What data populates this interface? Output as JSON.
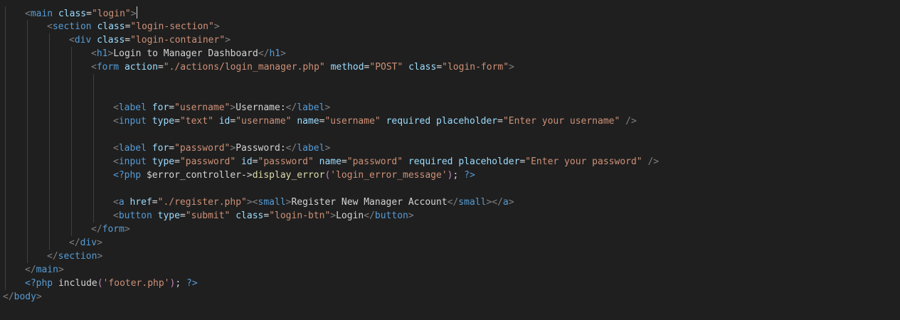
{
  "editor": {
    "lines": [
      {
        "indent": 1,
        "cursor": true,
        "tokens": [
          [
            "punc",
            "<"
          ],
          [
            "tag",
            "main"
          ],
          [
            "text",
            " "
          ],
          [
            "attr",
            "class"
          ],
          [
            "text",
            "="
          ],
          [
            "str",
            "\"login\""
          ],
          [
            "punc",
            ">"
          ]
        ]
      },
      {
        "indent": 2,
        "tokens": [
          [
            "punc",
            "<"
          ],
          [
            "tag",
            "section"
          ],
          [
            "text",
            " "
          ],
          [
            "attr",
            "class"
          ],
          [
            "text",
            "="
          ],
          [
            "str",
            "\"login-section\""
          ],
          [
            "punc",
            ">"
          ]
        ]
      },
      {
        "indent": 3,
        "tokens": [
          [
            "punc",
            "<"
          ],
          [
            "tag",
            "div"
          ],
          [
            "text",
            " "
          ],
          [
            "attr",
            "class"
          ],
          [
            "text",
            "="
          ],
          [
            "str",
            "\"login-container\""
          ],
          [
            "punc",
            ">"
          ]
        ]
      },
      {
        "indent": 4,
        "tokens": [
          [
            "punc",
            "<"
          ],
          [
            "tag",
            "h1"
          ],
          [
            "punc",
            ">"
          ],
          [
            "text",
            "Login to Manager Dashboard"
          ],
          [
            "punc",
            "</"
          ],
          [
            "tag",
            "h1"
          ],
          [
            "punc",
            ">"
          ]
        ]
      },
      {
        "indent": 4,
        "tokens": [
          [
            "punc",
            "<"
          ],
          [
            "tag",
            "form"
          ],
          [
            "text",
            " "
          ],
          [
            "attr",
            "action"
          ],
          [
            "text",
            "="
          ],
          [
            "str",
            "\"./actions/login_manager.php\""
          ],
          [
            "text",
            " "
          ],
          [
            "attr",
            "method"
          ],
          [
            "text",
            "="
          ],
          [
            "str",
            "\"POST\""
          ],
          [
            "text",
            " "
          ],
          [
            "attr",
            "class"
          ],
          [
            "text",
            "="
          ],
          [
            "str",
            "\"login-form\""
          ],
          [
            "punc",
            ">"
          ]
        ]
      },
      {
        "indent": 5,
        "tokens": []
      },
      {
        "indent": 5,
        "tokens": []
      },
      {
        "indent": 5,
        "tokens": [
          [
            "punc",
            "<"
          ],
          [
            "tag",
            "label"
          ],
          [
            "text",
            " "
          ],
          [
            "attr",
            "for"
          ],
          [
            "text",
            "="
          ],
          [
            "str",
            "\"username\""
          ],
          [
            "punc",
            ">"
          ],
          [
            "text",
            "Username:"
          ],
          [
            "punc",
            "</"
          ],
          [
            "tag",
            "label"
          ],
          [
            "punc",
            ">"
          ]
        ]
      },
      {
        "indent": 5,
        "tokens": [
          [
            "punc",
            "<"
          ],
          [
            "tag",
            "input"
          ],
          [
            "text",
            " "
          ],
          [
            "attr",
            "type"
          ],
          [
            "text",
            "="
          ],
          [
            "str",
            "\"text\""
          ],
          [
            "text",
            " "
          ],
          [
            "attr",
            "id"
          ],
          [
            "text",
            "="
          ],
          [
            "str",
            "\"username\""
          ],
          [
            "text",
            " "
          ],
          [
            "attr",
            "name"
          ],
          [
            "text",
            "="
          ],
          [
            "str",
            "\"username\""
          ],
          [
            "text",
            " "
          ],
          [
            "attr",
            "required"
          ],
          [
            "text",
            " "
          ],
          [
            "attr",
            "placeholder"
          ],
          [
            "text",
            "="
          ],
          [
            "str",
            "\"Enter your username\""
          ],
          [
            "text",
            " "
          ],
          [
            "punc",
            "/>"
          ]
        ]
      },
      {
        "indent": 5,
        "tokens": []
      },
      {
        "indent": 5,
        "tokens": [
          [
            "punc",
            "<"
          ],
          [
            "tag",
            "label"
          ],
          [
            "text",
            " "
          ],
          [
            "attr",
            "for"
          ],
          [
            "text",
            "="
          ],
          [
            "str",
            "\"password\""
          ],
          [
            "punc",
            ">"
          ],
          [
            "text",
            "Password:"
          ],
          [
            "punc",
            "</"
          ],
          [
            "tag",
            "label"
          ],
          [
            "punc",
            ">"
          ]
        ]
      },
      {
        "indent": 5,
        "tokens": [
          [
            "punc",
            "<"
          ],
          [
            "tag",
            "input"
          ],
          [
            "text",
            " "
          ],
          [
            "attr",
            "type"
          ],
          [
            "text",
            "="
          ],
          [
            "str",
            "\"password\""
          ],
          [
            "text",
            " "
          ],
          [
            "attr",
            "id"
          ],
          [
            "text",
            "="
          ],
          [
            "str",
            "\"password\""
          ],
          [
            "text",
            " "
          ],
          [
            "attr",
            "name"
          ],
          [
            "text",
            "="
          ],
          [
            "str",
            "\"password\""
          ],
          [
            "text",
            " "
          ],
          [
            "attr",
            "required"
          ],
          [
            "text",
            " "
          ],
          [
            "attr",
            "placeholder"
          ],
          [
            "text",
            "="
          ],
          [
            "str",
            "\"Enter your password\""
          ],
          [
            "text",
            " "
          ],
          [
            "punc",
            "/>"
          ]
        ]
      },
      {
        "indent": 5,
        "tokens": [
          [
            "php",
            "<?php"
          ],
          [
            "text",
            " $error_controller->"
          ],
          [
            "fn",
            "display_error"
          ],
          [
            "kw",
            "("
          ],
          [
            "str",
            "'login_error_message'"
          ],
          [
            "kw",
            ")"
          ],
          [
            "text",
            "; "
          ],
          [
            "php",
            "?>"
          ]
        ]
      },
      {
        "indent": 5,
        "tokens": []
      },
      {
        "indent": 5,
        "tokens": [
          [
            "punc",
            "<"
          ],
          [
            "tag",
            "a"
          ],
          [
            "text",
            " "
          ],
          [
            "attr",
            "href"
          ],
          [
            "text",
            "="
          ],
          [
            "str",
            "\"./register.php\""
          ],
          [
            "punc",
            "><"
          ],
          [
            "tag",
            "small"
          ],
          [
            "punc",
            ">"
          ],
          [
            "text",
            "Register New Manager Account"
          ],
          [
            "punc",
            "</"
          ],
          [
            "tag",
            "small"
          ],
          [
            "punc",
            "></"
          ],
          [
            "tag",
            "a"
          ],
          [
            "punc",
            ">"
          ]
        ]
      },
      {
        "indent": 5,
        "tokens": [
          [
            "punc",
            "<"
          ],
          [
            "tag",
            "button"
          ],
          [
            "text",
            " "
          ],
          [
            "attr",
            "type"
          ],
          [
            "text",
            "="
          ],
          [
            "str",
            "\"submit\""
          ],
          [
            "text",
            " "
          ],
          [
            "attr",
            "class"
          ],
          [
            "text",
            "="
          ],
          [
            "str",
            "\"login-btn\""
          ],
          [
            "punc",
            ">"
          ],
          [
            "text",
            "Login"
          ],
          [
            "punc",
            "</"
          ],
          [
            "tag",
            "button"
          ],
          [
            "punc",
            ">"
          ]
        ]
      },
      {
        "indent": 4,
        "tokens": [
          [
            "punc",
            "</"
          ],
          [
            "tag",
            "form"
          ],
          [
            "punc",
            ">"
          ]
        ]
      },
      {
        "indent": 3,
        "tokens": [
          [
            "punc",
            "</"
          ],
          [
            "tag",
            "div"
          ],
          [
            "punc",
            ">"
          ]
        ]
      },
      {
        "indent": 2,
        "tokens": [
          [
            "punc",
            "</"
          ],
          [
            "tag",
            "section"
          ],
          [
            "punc",
            ">"
          ]
        ]
      },
      {
        "indent": 1,
        "tokens": [
          [
            "punc",
            "</"
          ],
          [
            "tag",
            "main"
          ],
          [
            "punc",
            ">"
          ]
        ]
      },
      {
        "indent": 1,
        "tokens": [
          [
            "php",
            "<?php"
          ],
          [
            "text",
            " include"
          ],
          [
            "kw",
            "("
          ],
          [
            "str",
            "'footer.php'"
          ],
          [
            "kw",
            ")"
          ],
          [
            "text",
            "; "
          ],
          [
            "php",
            "?>"
          ]
        ]
      },
      {
        "indent": 0,
        "tokens": [
          [
            "punc",
            "</"
          ],
          [
            "tag",
            "body"
          ],
          [
            "punc",
            ">"
          ]
        ]
      }
    ]
  }
}
